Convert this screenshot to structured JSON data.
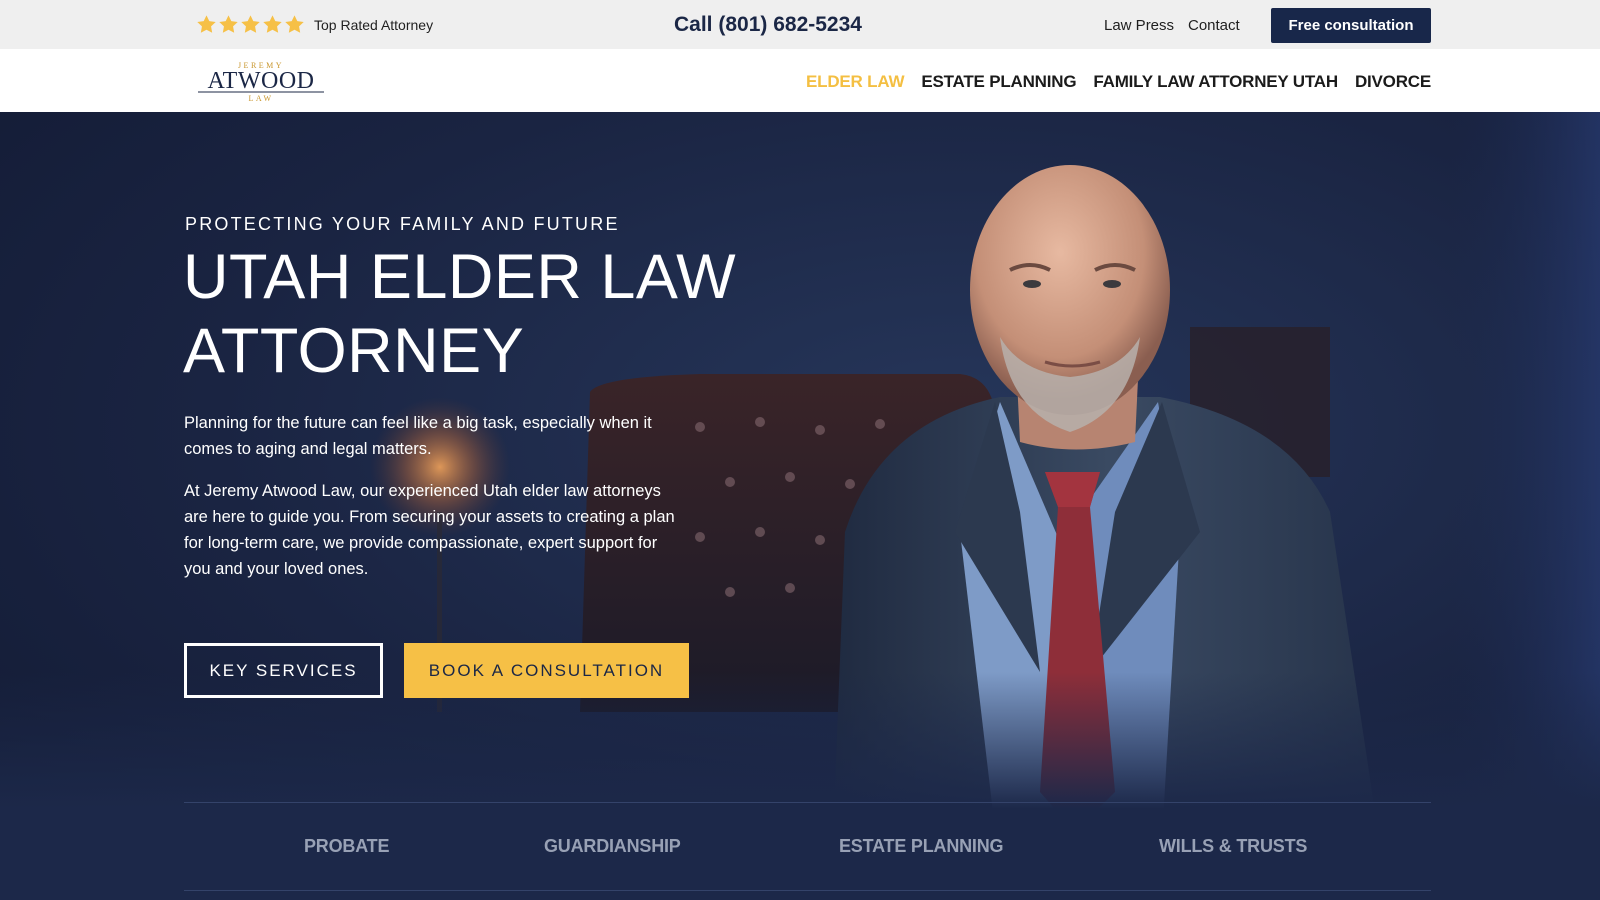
{
  "topbar": {
    "stars_count": 5,
    "rating_label": "Top Rated Attorney",
    "phone": "Call (801) 682-5234",
    "links": [
      "Law Press",
      "Contact"
    ],
    "cta": "Free consultation"
  },
  "logo": {
    "top": "JEREMY",
    "main": "ATWOOD",
    "sub": "LAW"
  },
  "nav": {
    "items": [
      "ELDER LAW",
      "ESTATE PLANNING",
      "FAMILY LAW ATTORNEY UTAH",
      "DIVORCE"
    ],
    "active": "ELDER LAW"
  },
  "hero": {
    "eyebrow": "PROTECTING YOUR FAMILY AND FUTURE",
    "title": "UTAH ELDER LAW ATTORNEY",
    "paragraph1": "Planning for the future can feel like a big task, especially when it comes to aging and legal matters.",
    "paragraph2": "At Jeremy Atwood Law, our experienced Utah elder law attorneys are here to guide you. From securing your assets to creating a plan for long-term care, we provide compassionate, expert support for you and your loved ones.",
    "button_secondary": "KEY SERVICES",
    "button_primary": "BOOK A CONSULTATION"
  },
  "services": [
    "PROBATE",
    "GUARDIANSHIP",
    "ESTATE PLANNING",
    "WILLS & TRUSTS"
  ],
  "colors": {
    "accent": "#f6c046",
    "navy": "#18274a",
    "topbar_bg": "#efefef"
  }
}
